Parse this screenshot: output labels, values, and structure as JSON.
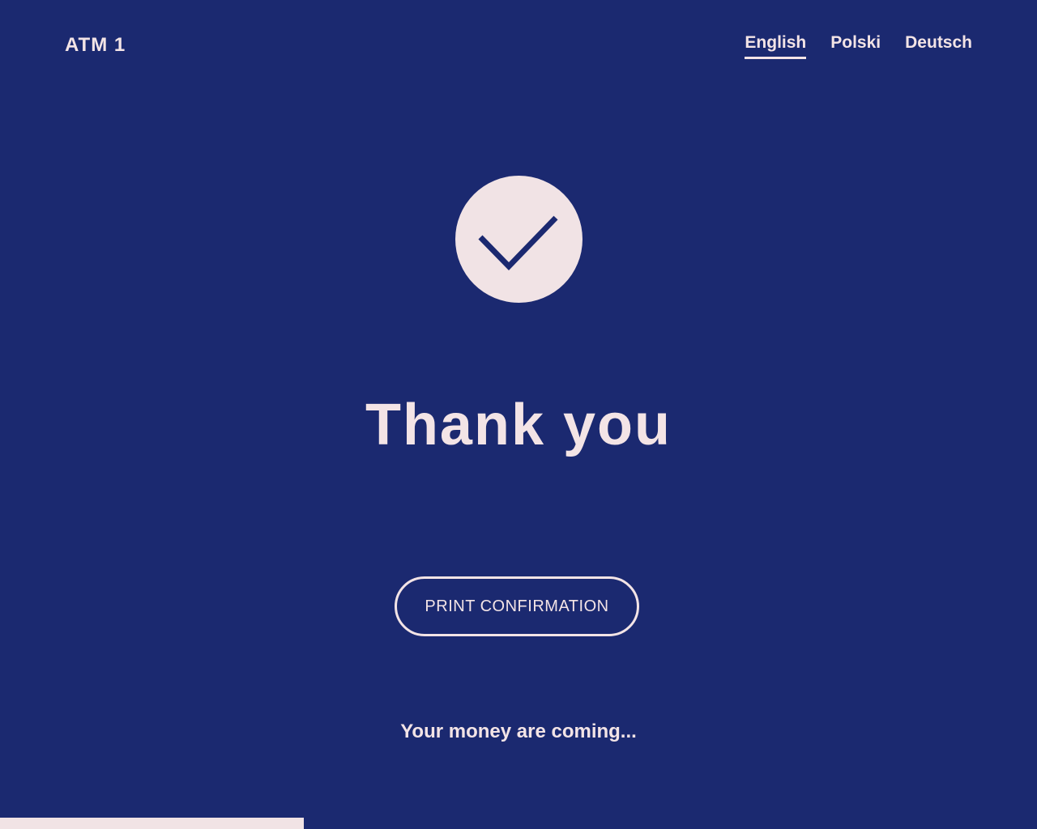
{
  "header": {
    "atm_label": "ATM 1",
    "languages": [
      {
        "label": "English",
        "active": true
      },
      {
        "label": "Polski",
        "active": false
      },
      {
        "label": "Deutsch",
        "active": false
      }
    ]
  },
  "main": {
    "status_icon": "checkmark-icon",
    "title": "Thank you",
    "print_button_label": "PRINT CONFIRMATION",
    "status_message": "Your money are coming..."
  },
  "colors": {
    "background": "#1b2970",
    "foreground": "#f3e4e6",
    "icon_fill": "#f1e3e5",
    "checkmark": "#1b2970"
  }
}
